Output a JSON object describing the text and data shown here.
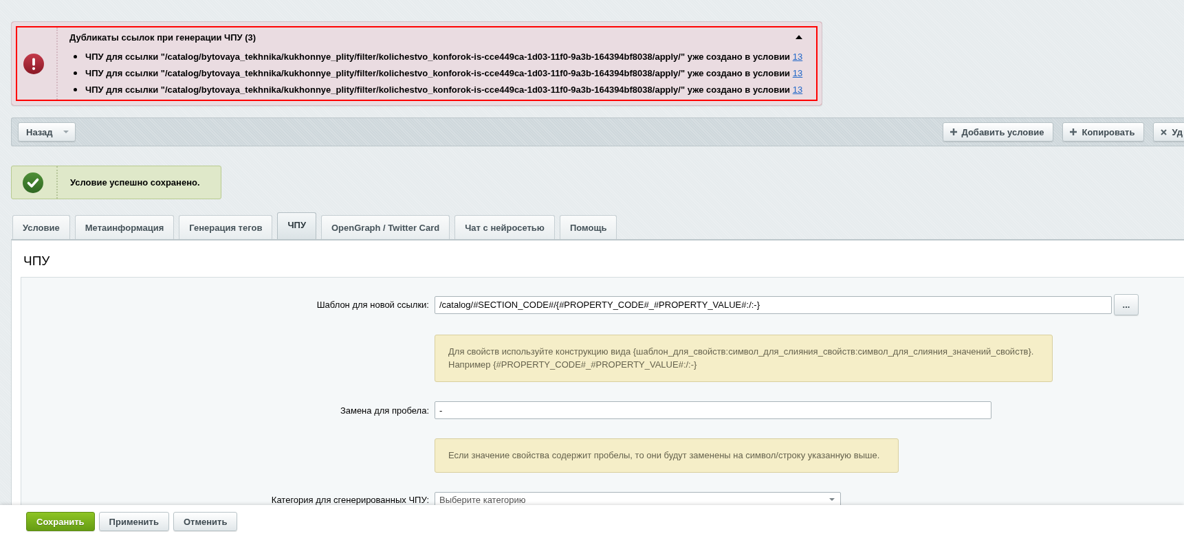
{
  "error_panel": {
    "title": "Дубликаты ссылок при генерации ЧПУ (3)",
    "expanded": true,
    "items": [
      {
        "text": "ЧПУ для ссылки \"/catalog/bytovaya_tekhnika/kukhonnye_plity/filter/kolichestvo_konforok-is-cce449ca-1d03-11f0-9a3b-164394bf8038/apply/\" уже создано в условии",
        "link": "13"
      },
      {
        "text": "ЧПУ для ссылки \"/catalog/bytovaya_tekhnika/kukhonnye_plity/filter/kolichestvo_konforok-is-cce449ca-1d03-11f0-9a3b-164394bf8038/apply/\" уже создано в условии",
        "link": "13"
      },
      {
        "text": "ЧПУ для ссылки \"/catalog/bytovaya_tekhnika/kukhonnye_plity/filter/kolichestvo_konforok-is-cce449ca-1d03-11f0-9a3b-164394bf8038/apply/\" уже создано в условии",
        "link": "13"
      }
    ]
  },
  "toolbar": {
    "left": [
      {
        "label": "Назад",
        "kind": "back"
      }
    ],
    "right": [
      {
        "label": "Добавить условие",
        "kind": "add"
      },
      {
        "label": "Копировать",
        "kind": "copy"
      },
      {
        "label": "Уд",
        "kind": "delete"
      }
    ]
  },
  "success_message": {
    "text": "Условие успешно сохранено."
  },
  "tabs": [
    {
      "label": "Условие",
      "selected": false
    },
    {
      "label": "Метаинформация",
      "selected": false
    },
    {
      "label": "Генерация тегов",
      "selected": false
    },
    {
      "label": "ЧПУ",
      "selected": true
    },
    {
      "label": "OpenGraph / Twitter Card",
      "selected": false
    },
    {
      "label": "Чат с нейросетью",
      "selected": false
    },
    {
      "label": "Помощь",
      "selected": false
    }
  ],
  "section": {
    "title": "ЧПУ",
    "fields": [
      {
        "kind": "text",
        "label": "Шаблон для новой ссылки:",
        "value": "/catalog/#SECTION_CODE#/{#PROPERTY_CODE#_#PROPERTY_VALUE#:/:-}",
        "button": "..."
      },
      {
        "kind": "note",
        "lines": [
          "Для свойств используйте конструкцию вида {шаблон_для_свойств:символ_для_слияния_свойств:символ_для_слияния_значений_свойств}.",
          "Например {#PROPERTY_CODE#_#PROPERTY_VALUE#:/:-}"
        ]
      },
      {
        "kind": "text",
        "label": "Замена для пробела:",
        "value": "-"
      },
      {
        "kind": "note",
        "lines": [
          "Если значение свойства содержит пробелы, то они будут заменены на символ/строку указанную выше."
        ]
      },
      {
        "kind": "select",
        "label": "Категория для сгенерированных ЧПУ:",
        "value": "Выберите категорию"
      }
    ]
  },
  "footer": {
    "buttons": [
      {
        "label": "Сохранить",
        "kind": "save"
      },
      {
        "label": "Применить",
        "kind": "apply"
      },
      {
        "label": "Отменить",
        "kind": "cancel"
      }
    ]
  }
}
